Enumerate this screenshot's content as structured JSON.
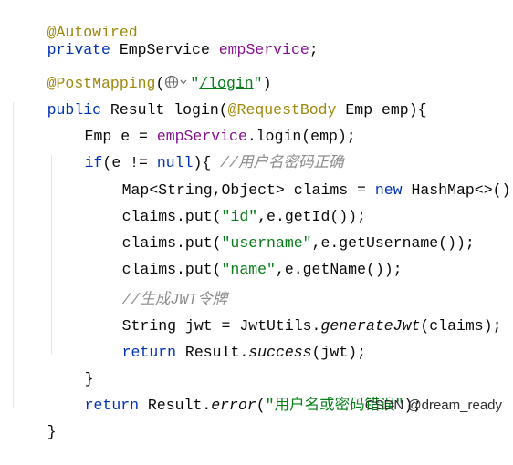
{
  "code": {
    "l1_annotation": "@Autowired",
    "l2_private": "private",
    "l2_type": " EmpService ",
    "l2_field": "empService",
    "l2_semi": ";",
    "l3_annotation": "@PostMapping",
    "l3_paren_open": "(",
    "l3_quote_open": "\"",
    "l3_path": "/login",
    "l3_quote_close": "\"",
    "l3_paren_close": ")",
    "l4_public": "public",
    "l4_sig": " Result login(",
    "l4_annotation": "@RequestBody",
    "l4_rest": " Emp emp){",
    "l5_a": "Emp e = ",
    "l5_field": "empService",
    "l5_b": ".login(emp);",
    "l6_if": "if",
    "l6_a": "(e != ",
    "l6_null": "null",
    "l6_b": "){ ",
    "l6_comment": "//用户名密码正确",
    "l7_a": "Map<String,Object> claims = ",
    "l7_new": "new",
    "l7_b": " HashMap<>();",
    "l8_a": "claims.put(",
    "l8_str": "\"id\"",
    "l8_b": ",e.getId());",
    "l9_a": "claims.put(",
    "l9_str": "\"username\"",
    "l9_b": ",e.getUsername());",
    "l10_a": "claims.put(",
    "l10_str": "\"name\"",
    "l10_b": ",e.getName());",
    "l11_comment": "//生成JWT令牌",
    "l12_a": "String jwt = JwtUtils.",
    "l12_method": "generateJwt",
    "l12_b": "(claims);",
    "l13_return": "return",
    "l13_a": " Result.",
    "l13_method": "success",
    "l13_b": "(jwt);",
    "l14_brace": "}",
    "l15_return": "return",
    "l15_a": " Result.",
    "l15_method": "error",
    "l15_paren": "(",
    "l15_str": "\"用户名或密码错误\"",
    "l15_b": ");",
    "l16_brace": "}"
  },
  "icons": {
    "gutter": "globe-chevron-icon"
  },
  "watermark": "CSDN @dream_ready",
  "colors": {
    "annotation": "#9e880d",
    "keyword": "#0033b3",
    "field": "#871094",
    "string": "#067d17",
    "comment": "#8c8c8c"
  }
}
